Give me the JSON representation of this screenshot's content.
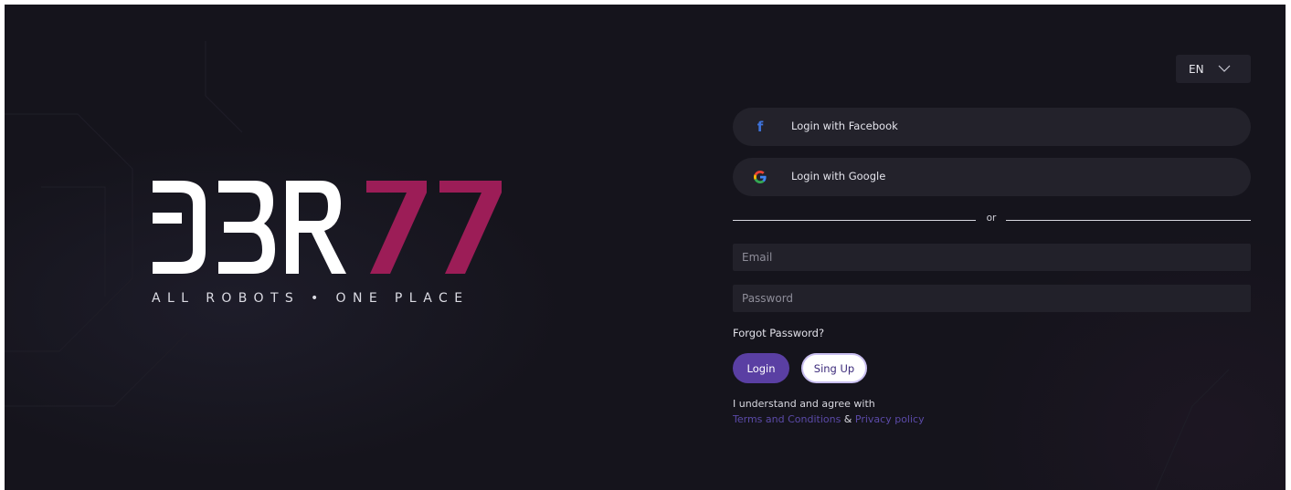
{
  "brand": {
    "logo_text": "DBR77",
    "tagline": "ALL ROBOTS • ONE PLACE",
    "colors": {
      "logo_white": "#ffffff",
      "logo_accent": "#9c1d57"
    }
  },
  "language": {
    "selected": "EN",
    "icon": "chevron-down-icon"
  },
  "social": {
    "facebook": {
      "label": "Login with Facebook",
      "icon": "facebook-icon",
      "color": "#3d72d9"
    },
    "google": {
      "label": "Login with Google",
      "icon": "google-icon"
    }
  },
  "divider": {
    "text": "or"
  },
  "form": {
    "email": {
      "placeholder": "Email",
      "value": ""
    },
    "password": {
      "placeholder": "Password",
      "value": ""
    },
    "forgot_label": "Forgot Password?",
    "login_label": "Login",
    "signup_label": "Sing Up"
  },
  "legal": {
    "agree_text": "I understand and agree with",
    "terms_label": "Terms and Conditions",
    "amp": " & ",
    "privacy_label": "Privacy policy"
  },
  "theme": {
    "background": "#15141c",
    "field_bg": "#22212a",
    "accent": "#5a3fa3",
    "link": "#5b4aa8"
  }
}
